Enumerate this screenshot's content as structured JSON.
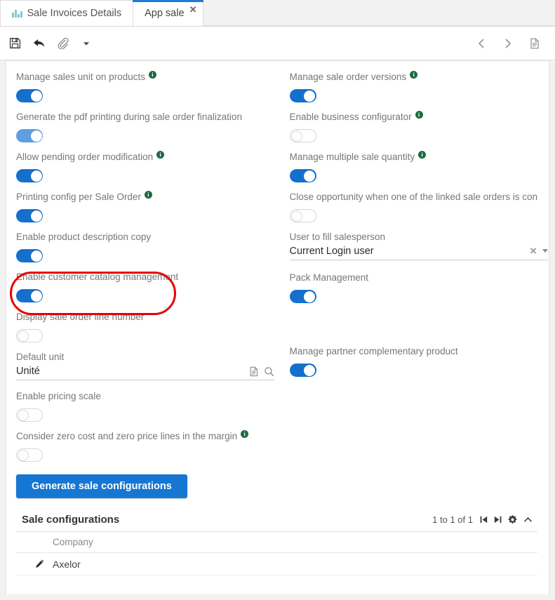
{
  "tabs": [
    {
      "label": "Sale Invoices Details",
      "icon": "bar-chart-icon",
      "active": false,
      "closable": false
    },
    {
      "label": "App sale",
      "active": true,
      "closable": true,
      "close_label": "✕"
    }
  ],
  "toolbar": {
    "save_label": "save-icon",
    "back_label": "back-arrow-icon",
    "attachment_label": "paperclip-icon",
    "more_label": "caret-down-icon",
    "prev_label": "‹",
    "next_label": "›",
    "doc_label": "document-icon"
  },
  "form": {
    "left": [
      {
        "type": "toggle",
        "label": "Manage sales unit on products",
        "info": true,
        "state": "on"
      },
      {
        "type": "toggle",
        "label": "Generate the pdf printing during sale order finalization",
        "info": false,
        "state": "on-light"
      },
      {
        "type": "toggle",
        "label": "Allow pending order modification",
        "info": true,
        "state": "on"
      },
      {
        "type": "toggle",
        "label": "Printing config per Sale Order",
        "info": true,
        "state": "on"
      },
      {
        "type": "toggle",
        "label": "Enable product description copy",
        "info": false,
        "state": "on"
      },
      {
        "type": "toggle",
        "label": "Enable customer catalog management",
        "info": false,
        "state": "on",
        "highlighted": true
      },
      {
        "type": "toggle",
        "label": "Display sale order line number",
        "info": false,
        "state": "off"
      },
      {
        "type": "text",
        "label": "Default unit",
        "value": "Unité",
        "icons": [
          "document-icon",
          "search-icon"
        ]
      },
      {
        "type": "toggle",
        "label": "Enable pricing scale",
        "info": false,
        "state": "off"
      },
      {
        "type": "toggle",
        "label": "Consider zero cost and zero price lines in the margin",
        "info": true,
        "state": "off"
      }
    ],
    "right": [
      {
        "type": "toggle",
        "label": "Manage sale order versions",
        "info": true,
        "state": "on"
      },
      {
        "type": "toggle",
        "label": "Enable business configurator",
        "info": true,
        "state": "off"
      },
      {
        "type": "toggle",
        "label": "Manage multiple sale quantity",
        "info": true,
        "state": "on"
      },
      {
        "type": "toggle",
        "label": "Close opportunity when one of the linked sale orders is confir...",
        "info": true,
        "state": "off"
      },
      {
        "type": "select",
        "label": "User to fill salesperson",
        "value": "Current Login user",
        "clear_label": "✕"
      },
      {
        "type": "toggle",
        "label": "Pack Management",
        "info": false,
        "state": "on"
      },
      {
        "type": "toggle",
        "label": "Manage partner complementary product",
        "info": false,
        "state": "on"
      }
    ]
  },
  "action_button": {
    "label": "Generate sale configurations"
  },
  "panel": {
    "title": "Sale configurations",
    "pager_text": "1 to 1 of 1",
    "first_page_label": "first-page-icon",
    "last_page_label": "last-page-icon",
    "settings_label": "gear-icon",
    "collapse_label": "chevron-up-icon",
    "columns": [
      "Company"
    ],
    "rows": [
      {
        "edit_icon": "pencil-icon",
        "company": "Axelor"
      }
    ]
  },
  "colors": {
    "accent": "#1570cd",
    "accent_light": "#5f9fe0",
    "button": "#1577d2",
    "info_icon": "#1b6b42",
    "highlight": "#e60000",
    "tab_active_bar": "#1d7ad6",
    "chart_icon": "#86c8d4"
  }
}
